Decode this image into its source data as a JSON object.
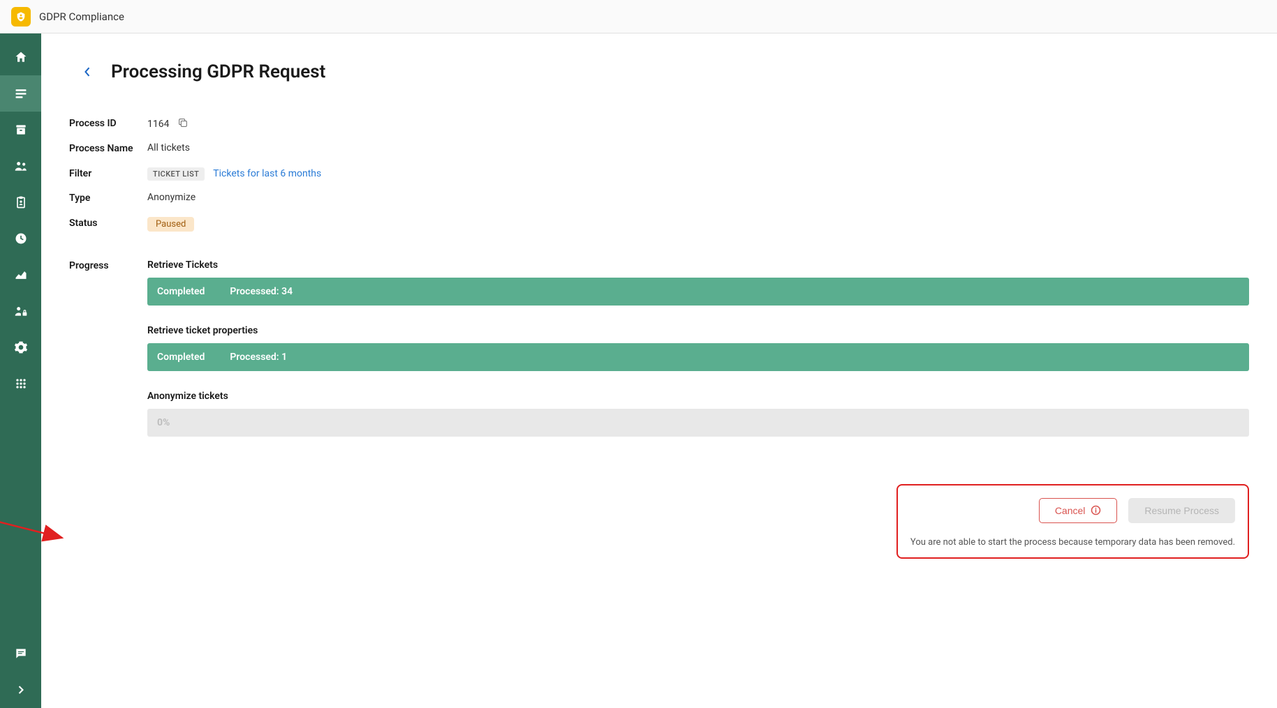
{
  "topbar": {
    "title": "GDPR Compliance"
  },
  "page": {
    "title": "Processing GDPR Request"
  },
  "details": {
    "process_id_label": "Process ID",
    "process_id_value": "1164",
    "process_name_label": "Process Name",
    "process_name_value": "All tickets",
    "filter_label": "Filter",
    "filter_tag": "TICKET LIST",
    "filter_link": "Tickets for last 6 months",
    "type_label": "Type",
    "type_value": "Anonymize",
    "status_label": "Status",
    "status_value": "Paused",
    "progress_label": "Progress"
  },
  "progress": {
    "section1_title": "Retrieve Tickets",
    "section1_status": "Completed",
    "section1_processed": "Processed: 34",
    "section2_title": "Retrieve ticket properties",
    "section2_status": "Completed",
    "section2_processed": "Processed: 1",
    "section3_title": "Anonymize tickets",
    "section3_percent": "0%"
  },
  "actions": {
    "cancel_label": "Cancel",
    "resume_label": "Resume Process",
    "note": "You are not able to start the process because temporary data has been removed."
  }
}
